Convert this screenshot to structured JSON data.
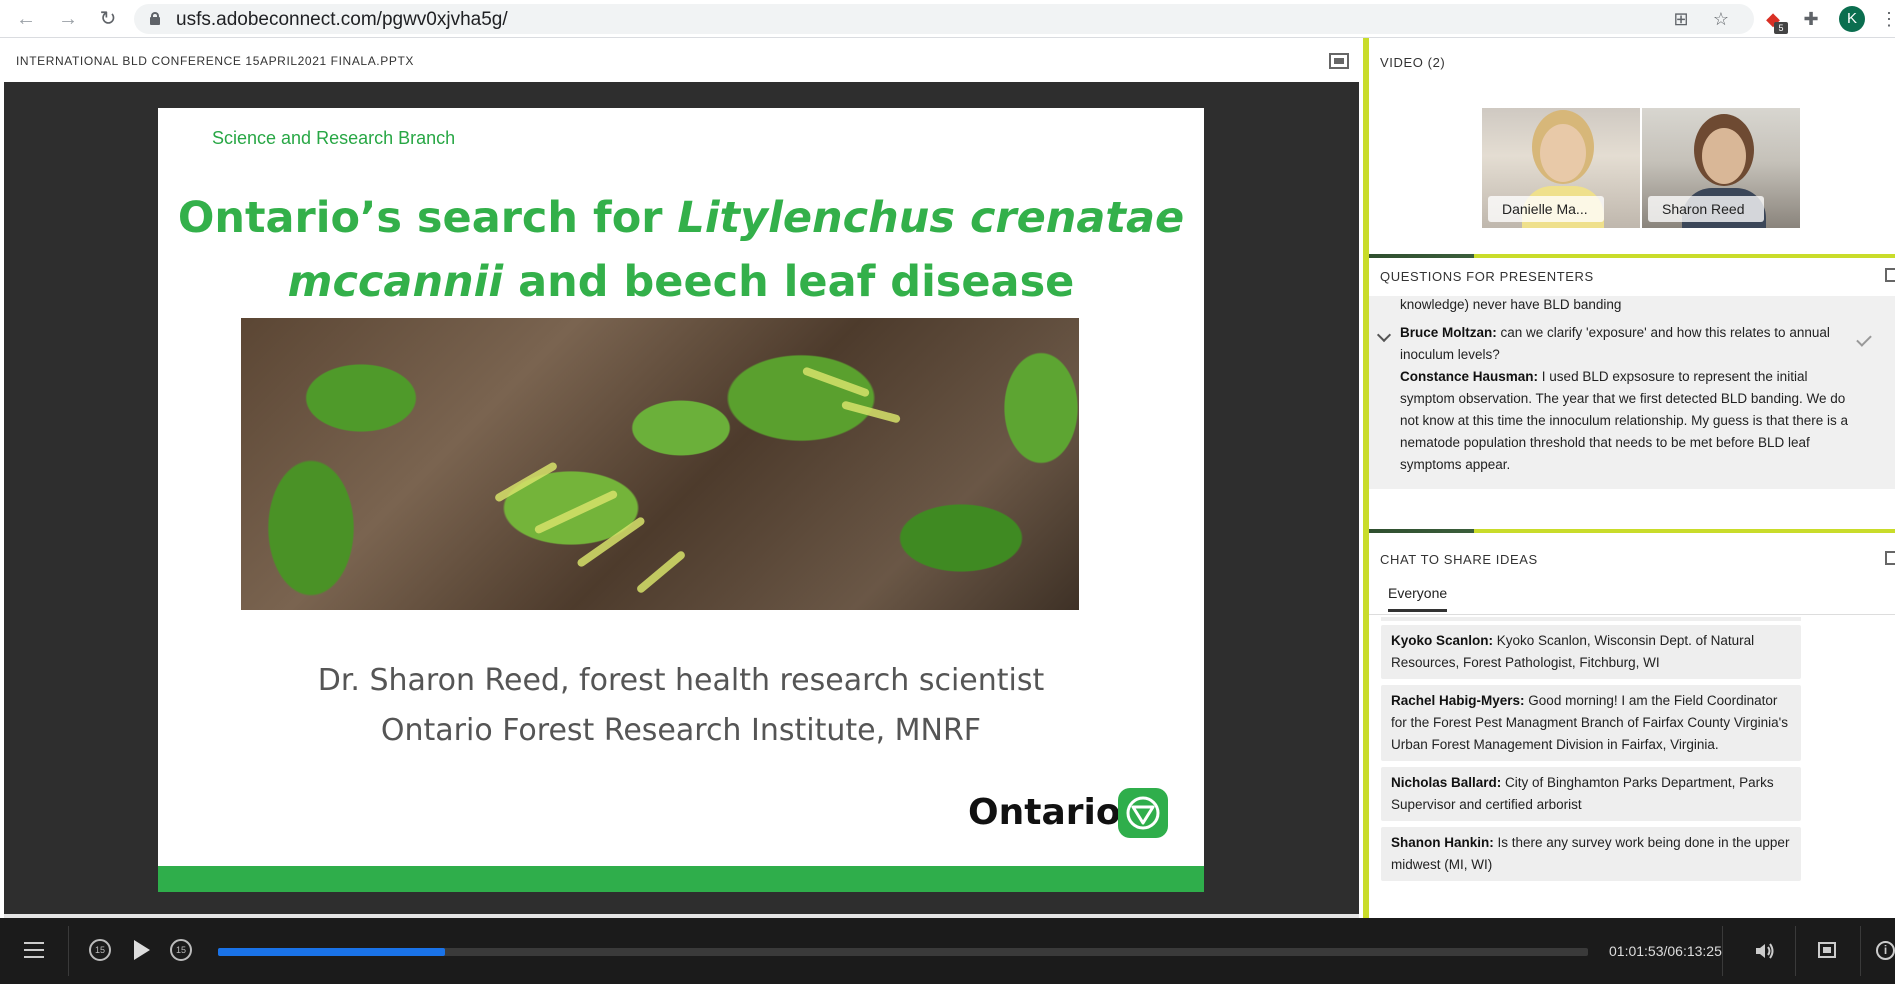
{
  "browser": {
    "url": "usfs.adobeconnect.com/pgwv0xjvha5g/",
    "extension_badge": "5",
    "profile_initial": "K",
    "icons": [
      "back-arrow-icon",
      "forward-arrow-icon",
      "reload-icon",
      "lock-icon",
      "translate-icon",
      "star-icon",
      "extension-icon",
      "puzzle-icon",
      "more-vertical-icon"
    ]
  },
  "share_pod": {
    "title": "INTERNATIONAL BLD CONFERENCE 15APRIL2021 FINALA.PPTX",
    "slide": {
      "branch": "Science and Research Branch",
      "title_line1_plain": "Ontario’s search for ",
      "title_line1_italic": "Litylenchus crenatae",
      "title_line2_italic": "mccannii",
      "title_line2_plain": " and beech leaf disease",
      "author_line1": "Dr. Sharon Reed, forest health research scientist",
      "author_line2": "Ontario Forest Research Institute, MNRF",
      "logo_word": "Ontario"
    }
  },
  "video_pod": {
    "title": "VIDEO (2)",
    "participants": [
      {
        "name": "Danielle Ma..."
      },
      {
        "name": "Sharon Reed"
      }
    ]
  },
  "qa_pod": {
    "title": "QUESTIONS FOR PRESENTERS",
    "partial_line": "knowledge) never have BLD banding",
    "question": {
      "author": "Bruce Moltzan:",
      "text": " can we clarify 'exposure' and how this relates to annual inoculum levels?"
    },
    "answer": {
      "author": "Constance Hausman:",
      "text": " I used BLD expsosure to represent the initial symptom observation. The year that we first detected BLD banding. We do not know at this time the innoculum relationship. My guess is that there is a nematode population threshold that needs to be met before BLD leaf symptoms appear."
    }
  },
  "chat_pod": {
    "title": "CHAT TO SHARE IDEAS",
    "tab": "Everyone",
    "messages": [
      {
        "author": "Kyoko Scanlon:",
        "text": " Kyoko Scanlon, Wisconsin Dept. of Natural Resources, Forest Pathologist, Fitchburg, WI"
      },
      {
        "author": "Rachel Habig-Myers:",
        "text": " Good morning! I am the Field Coordinator for the Forest Pest Managment Branch of Fairfax County Virginia's Urban Forest Management Division in Fairfax, Virginia."
      },
      {
        "author": "Nicholas Ballard:",
        "text": " City of Binghamton Parks Department, Parks Supervisor and certified arborist"
      },
      {
        "author": "Shanon Hankin:",
        "text": " Is there any survey work being done in the upper midwest (MI, WI)"
      }
    ]
  },
  "player": {
    "rewind_label": "15",
    "forward_label": "15",
    "time": "01:01:53/06:13:25",
    "progress_fraction": 0.1658
  },
  "colors": {
    "accent": "#1a73e8",
    "slide_green": "#33b04a",
    "pod_divider": "#c9dc2a"
  }
}
